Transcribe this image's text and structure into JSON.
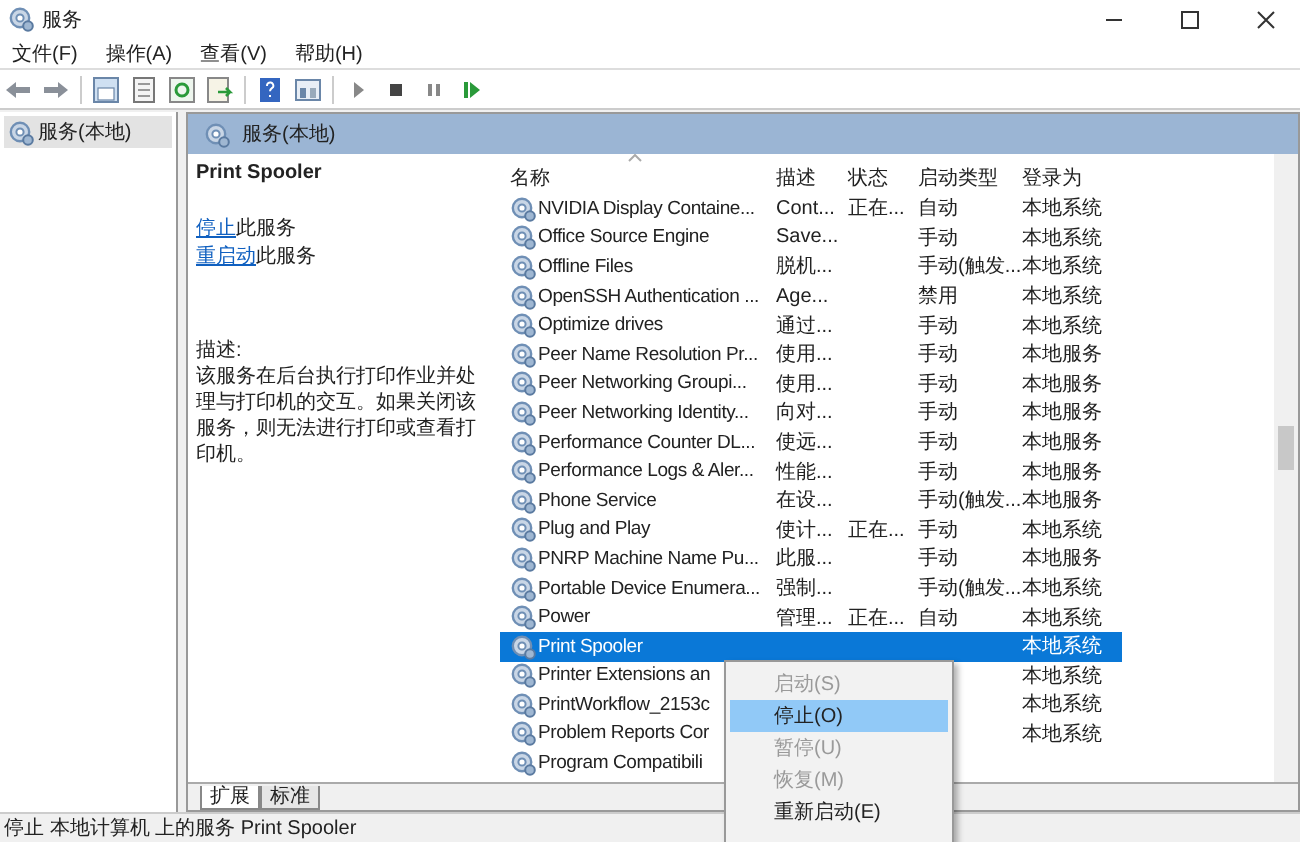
{
  "window": {
    "title": "服务"
  },
  "menu_bar": [
    "文件(F)",
    "操作(A)",
    "查看(V)",
    "帮助(H)"
  ],
  "tree": {
    "items": [
      {
        "label": "服务(本地)",
        "selected": true
      }
    ]
  },
  "panel": {
    "title": "服务(本地)"
  },
  "details": {
    "service_name": "Print Spooler",
    "actions": [
      {
        "link": "停止",
        "text": "此服务"
      },
      {
        "link": "重启动",
        "text": "此服务"
      }
    ],
    "description_label": "描述:",
    "description": "该服务在后台执行打印作业并处理与打印机的交互。如果关闭该服务，则无法进行打印或查看打印机。"
  },
  "table": {
    "columns": [
      "名称",
      "描述",
      "状态",
      "启动类型",
      "登录为"
    ],
    "rows": [
      {
        "name": "NVIDIA Display Containe...",
        "description": "Cont...",
        "status": "正在...",
        "startup": "自动",
        "logon": "本地系统",
        "selected": false
      },
      {
        "name": "Office  Source Engine",
        "description": "Save...",
        "startup": "手动",
        "logon": "本地系统",
        "selected": false
      },
      {
        "name": "Offline Files",
        "description": "脱机...",
        "startup": "手动(触发...",
        "logon": "本地系统",
        "selected": false
      },
      {
        "name": "OpenSSH Authentication ...",
        "description": "Age...",
        "startup": "禁用",
        "logon": "本地系统",
        "selected": false
      },
      {
        "name": "Optimize drives",
        "description": "通过...",
        "startup": "手动",
        "logon": "本地系统",
        "selected": false
      },
      {
        "name": "Peer Name Resolution Pr...",
        "description": "使用...",
        "startup": "手动",
        "logon": "本地服务",
        "selected": false
      },
      {
        "name": "Peer Networking Groupi...",
        "description": "使用...",
        "startup": "手动",
        "logon": "本地服务",
        "selected": false
      },
      {
        "name": "Peer Networking Identity...",
        "description": "向对...",
        "startup": "手动",
        "logon": "本地服务",
        "selected": false
      },
      {
        "name": "Performance Counter DL...",
        "description": "使远...",
        "startup": "手动",
        "logon": "本地服务",
        "selected": false
      },
      {
        "name": "Performance Logs & Aler...",
        "description": "性能...",
        "startup": "手动",
        "logon": "本地服务",
        "selected": false
      },
      {
        "name": "Phone Service",
        "description": "在设...",
        "startup": "手动(触发...",
        "logon": "本地服务",
        "selected": false
      },
      {
        "name": "Plug and Play",
        "description": "使计...",
        "status": "正在...",
        "startup": "手动",
        "logon": "本地系统",
        "selected": false
      },
      {
        "name": "PNRP Machine Name Pu...",
        "description": "此服...",
        "startup": "手动",
        "logon": "本地服务",
        "selected": false
      },
      {
        "name": "Portable Device Enumera...",
        "description": "强制...",
        "startup": "手动(触发...",
        "logon": "本地系统",
        "selected": false
      },
      {
        "name": "Power",
        "description": "管理...",
        "status": "正在...",
        "startup": "自动",
        "logon": "本地系统",
        "selected": false
      },
      {
        "name": "Print Spooler",
        "logon": "本地系统",
        "selected": true
      },
      {
        "name": "Printer Extensions an",
        "logon": "本地系统",
        "selected": false
      },
      {
        "name": "PrintWorkflow_2153c",
        "logon": "本地系统",
        "selected": false
      },
      {
        "name": "Problem Reports Cor",
        "logon": "本地系统",
        "selected": false
      },
      {
        "name": "Program Compatibili",
        "selected": false
      }
    ]
  },
  "bottom_tabs": [
    {
      "label": "扩展",
      "selected": true
    },
    {
      "label": "标准",
      "selected": false
    }
  ],
  "context_menu": [
    {
      "label": "启动(S)",
      "disabled": true,
      "selected": false
    },
    {
      "label": "停止(O)",
      "disabled": false,
      "selected": true
    },
    {
      "label": "暂停(U)",
      "disabled": true,
      "selected": false
    },
    {
      "label": "恢复(M)",
      "disabled": true,
      "selected": false
    },
    {
      "label": "重新启动(E)",
      "disabled": false,
      "selected": false
    }
  ],
  "status_bar": "停止 本地计算机 上的服务 Print Spooler"
}
